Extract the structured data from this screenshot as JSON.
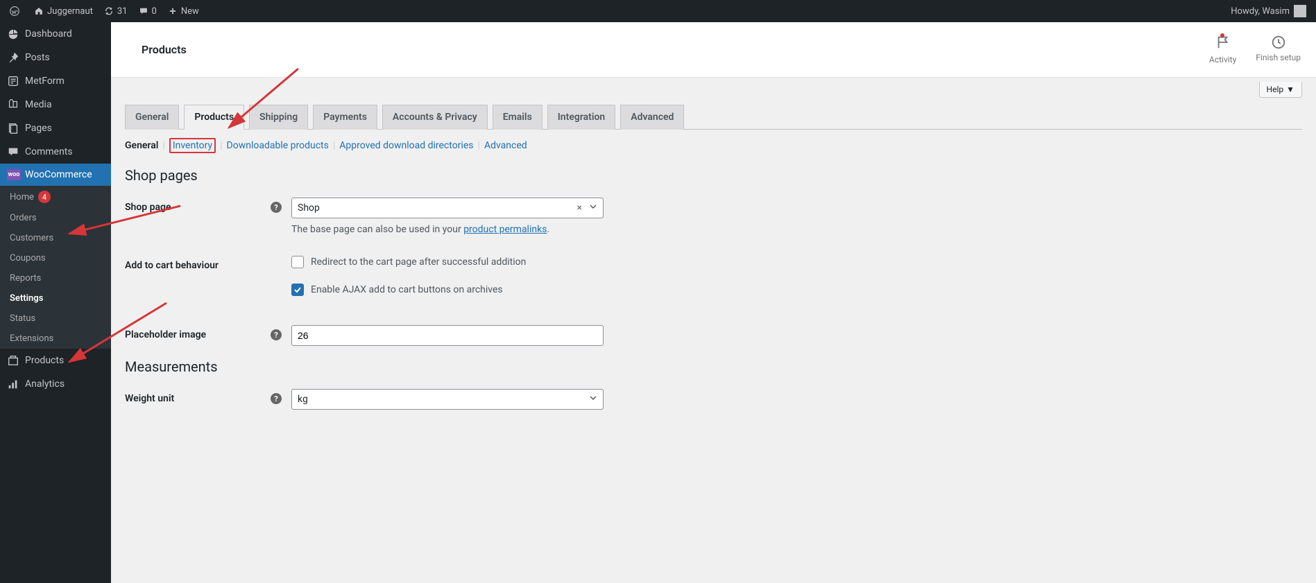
{
  "adminbar": {
    "site_name": "Juggernaut",
    "updates_count": "31",
    "comments_count": "0",
    "new_label": "New",
    "howdy": "Howdy, Wasim"
  },
  "menu": {
    "dashboard": "Dashboard",
    "posts": "Posts",
    "metform": "MetForm",
    "media": "Media",
    "pages": "Pages",
    "comments": "Comments",
    "woocommerce": "WooCommerce",
    "products": "Products",
    "analytics": "Analytics"
  },
  "submenu": {
    "home": "Home",
    "home_count": "4",
    "orders": "Orders",
    "customers": "Customers",
    "coupons": "Coupons",
    "reports": "Reports",
    "settings": "Settings",
    "status": "Status",
    "extensions": "Extensions"
  },
  "header": {
    "title": "Products",
    "activity": "Activity",
    "finish_setup": "Finish setup",
    "help": "Help"
  },
  "tabs": {
    "general": "General",
    "products": "Products",
    "shipping": "Shipping",
    "payments": "Payments",
    "accounts": "Accounts & Privacy",
    "emails": "Emails",
    "integration": "Integration",
    "advanced": "Advanced"
  },
  "subtabs": {
    "general": "General",
    "inventory": "Inventory",
    "downloadable": "Downloadable products",
    "approved": "Approved download directories",
    "advanced": "Advanced"
  },
  "sections": {
    "shop_pages": "Shop pages",
    "measurements": "Measurements"
  },
  "form": {
    "shop_page_label": "Shop page",
    "shop_page_value": "Shop",
    "shop_page_desc_prefix": "The base page can also be used in your ",
    "shop_page_desc_link": "product permalinks",
    "add_to_cart_label": "Add to cart behaviour",
    "redirect_label": "Redirect to the cart page after successful addition",
    "ajax_label": "Enable AJAX add to cart buttons on archives",
    "placeholder_label": "Placeholder image",
    "placeholder_value": "26",
    "weight_label": "Weight unit",
    "weight_value": "kg"
  }
}
